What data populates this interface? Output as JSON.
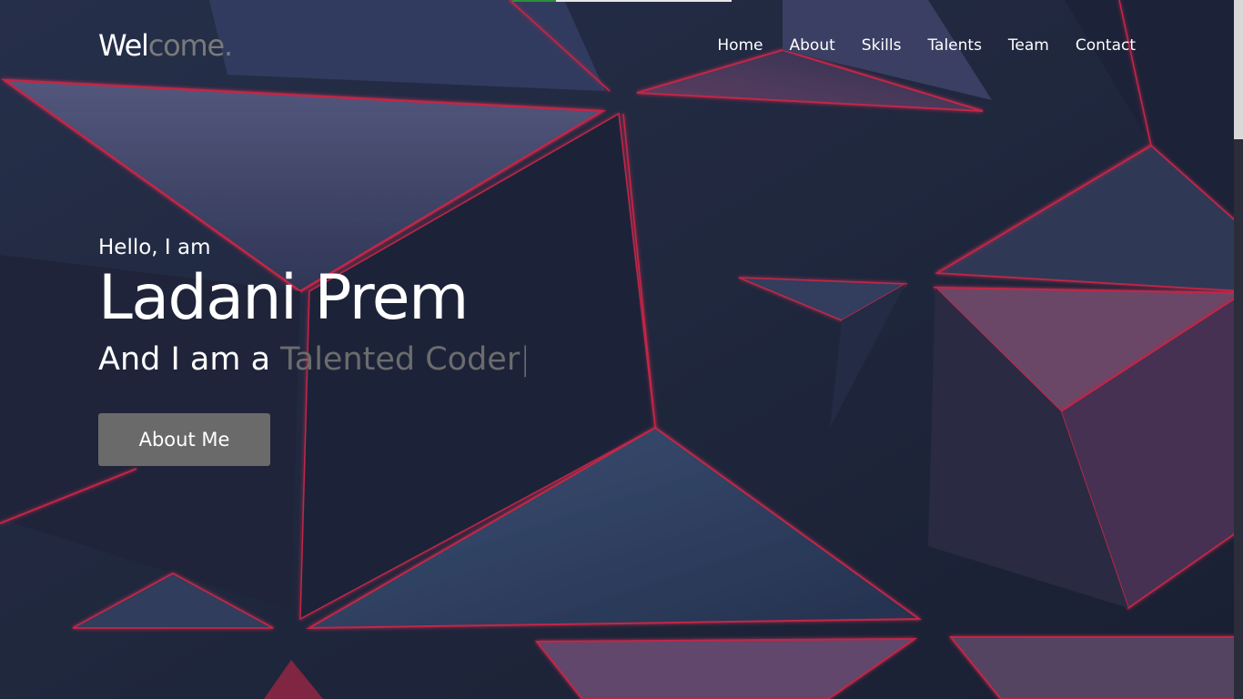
{
  "brand": {
    "logo_main": "Wel",
    "logo_accent": "come."
  },
  "nav": {
    "items": [
      "Home",
      "About",
      "Skills",
      "Talents",
      "Team",
      "Contact"
    ]
  },
  "hero": {
    "greeting": "Hello, I am",
    "name": "Ladani Prem",
    "tagline_prefix": "And I am a ",
    "tagline_typed": "Talented Coder",
    "cursor": "|",
    "button_label": "About Me"
  },
  "colors": {
    "accent_gray": "#6c6c6c",
    "button_bg": "#6a6a6a",
    "text": "#ffffff",
    "glow_red": "#ff2d55"
  }
}
